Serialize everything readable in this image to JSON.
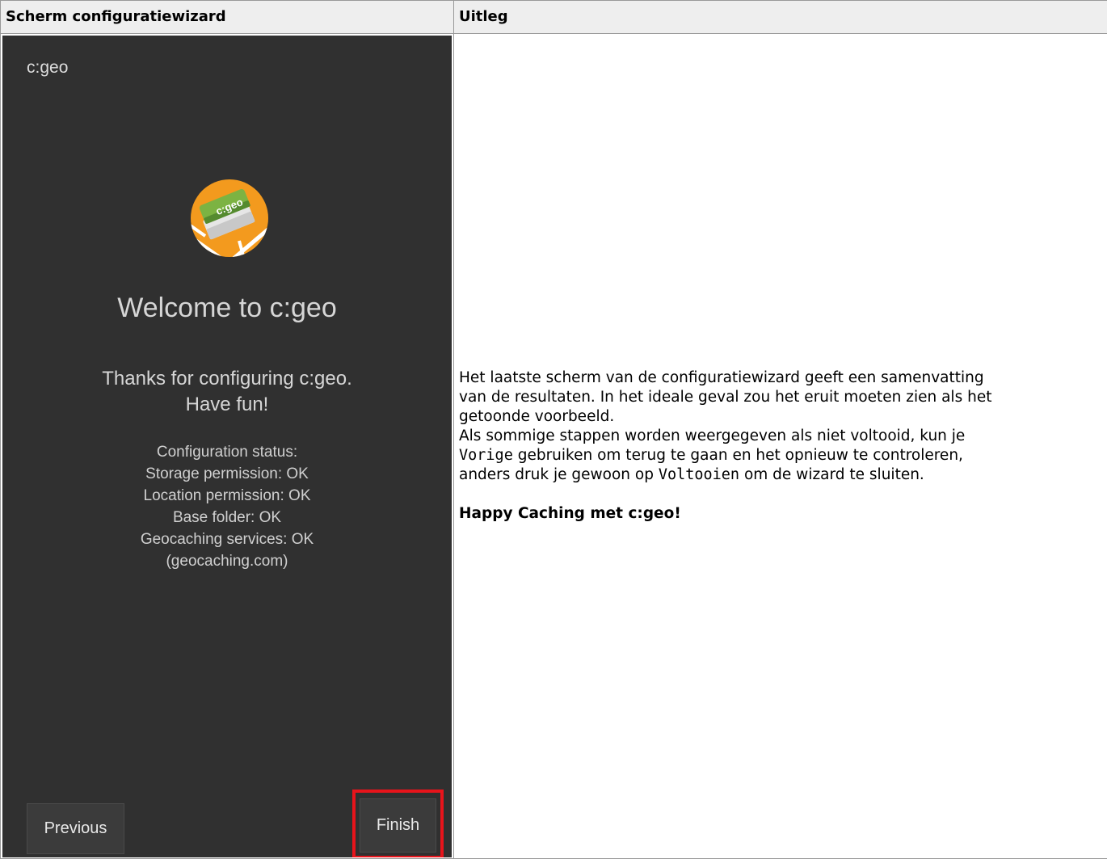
{
  "table": {
    "header_left": "Scherm configuratiewizard",
    "header_right": "Uitleg"
  },
  "phone": {
    "app_title": "c:geo",
    "logo_text": "c:geo",
    "welcome": "Welcome to c:geo",
    "thanks_line1": "Thanks for configuring c:geo.",
    "thanks_line2": "Have fun!",
    "status": [
      "Configuration status:",
      "Storage permission: OK",
      "Location permission: OK",
      "Base folder: OK",
      "Geocaching services: OK",
      "(geocaching.com)"
    ],
    "previous_button": "Previous",
    "finish_button": "Finish",
    "highlight_color": "#e8141b",
    "background_color": "#303030"
  },
  "explanation": {
    "line1": "Het laatste scherm van de configuratiewizard geeft een samenvatting",
    "line2": "van de resultaten. In het ideale geval zou het eruit moeten zien als het",
    "line3": "getoonde voorbeeld.",
    "line4": "Als sommige stappen worden weergegeven als niet voltooid, kun je",
    "line5_code": "Vorige",
    "line5_rest": " gebruiken om terug te gaan en het opnieuw te controleren,",
    "line6_pre": "anders druk je gewoon op ",
    "line6_code": "Voltooien",
    "line6_rest": " om de wizard te sluiten.",
    "happy": "Happy Caching met c:geo!"
  }
}
